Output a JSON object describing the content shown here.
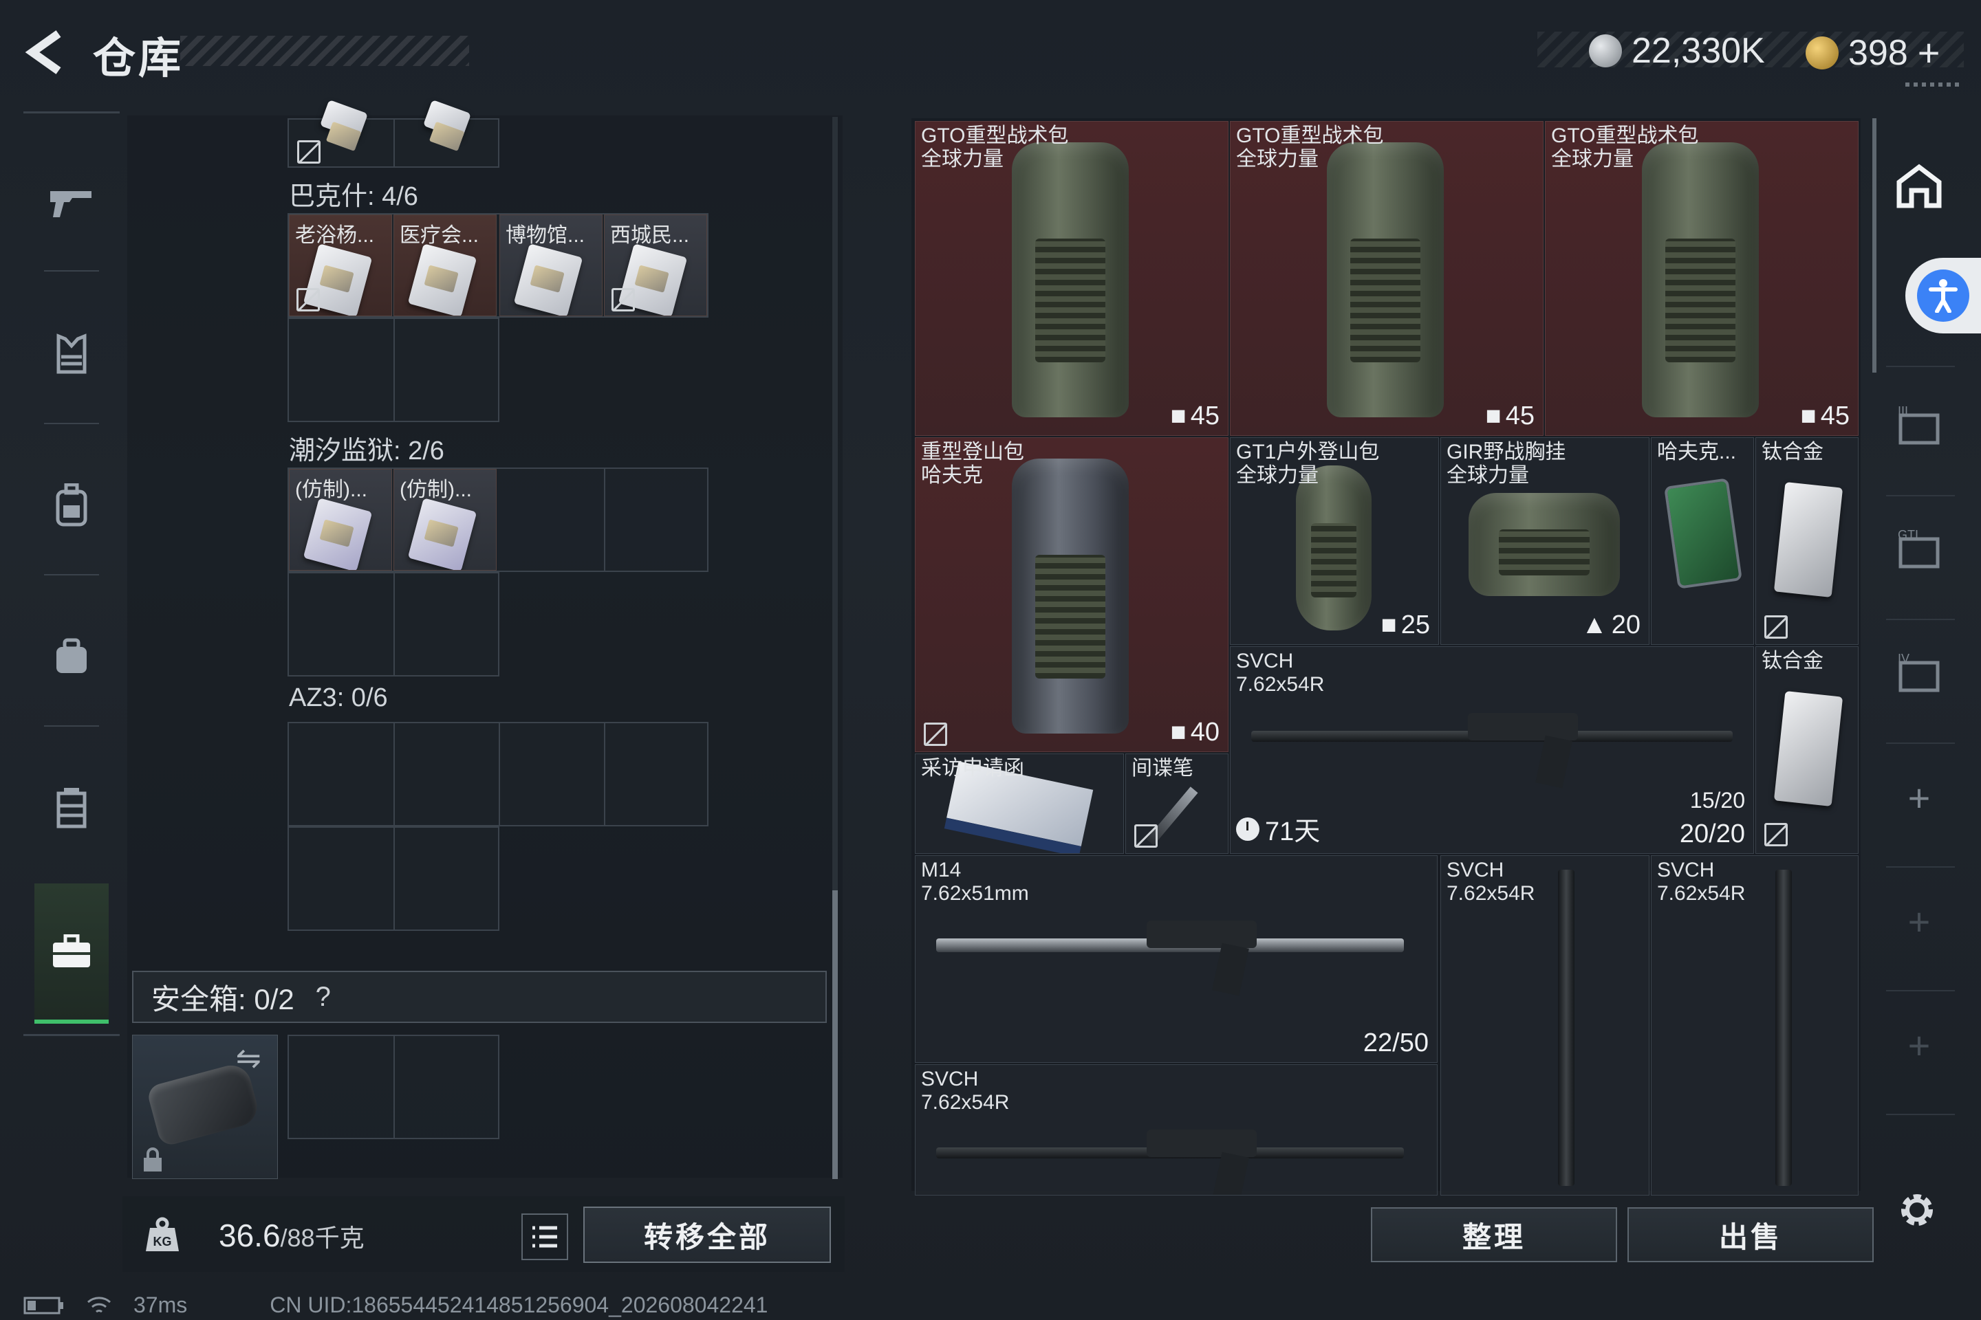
{
  "header": {
    "title": "仓库",
    "currency_1": "22,330K",
    "currency_2": "398",
    "add_label": "+"
  },
  "left_nav": {
    "items": [
      "weapons",
      "armor",
      "backpack",
      "chest-rig",
      "container",
      "toolbox"
    ]
  },
  "storage": {
    "sections": [
      {
        "label": "巴克什: 4/6",
        "cards": [
          "老浴杨...",
          "医疗会...",
          "博物馆...",
          "西城民..."
        ]
      },
      {
        "label": "潮汐监狱: 2/6",
        "cards": [
          "(仿制)...",
          "(仿制)..."
        ]
      },
      {
        "label": "AZ3: 0/6",
        "cards": []
      }
    ],
    "safebox_label": "安全箱: 0/2",
    "safebox_help": "?"
  },
  "bottom_left": {
    "weight_value": "36.6",
    "weight_max": "/88千克",
    "transfer_all": "转移全部"
  },
  "status": {
    "ping": "37ms",
    "uid": "CN UID:18655445241485125​6904_202608042241"
  },
  "stash": {
    "items": [
      {
        "name1": "GTO重型战术包",
        "name2": "全球力量",
        "count": "45"
      },
      {
        "name1": "GTO重型战术包",
        "name2": "全球力量",
        "count": "45"
      },
      {
        "name1": "GTO重型战术包",
        "name2": "全球力量",
        "count": "45"
      },
      {
        "name1": "重型登山包",
        "name2": "哈夫克",
        "count": "40"
      },
      {
        "name1": "GT1户外登山包",
        "name2": "全球力量",
        "count": "25"
      },
      {
        "name1": "GIR野战胸挂",
        "name2": "全球力量",
        "count": "20"
      },
      {
        "name1": "哈夫克...",
        "name2": ""
      },
      {
        "name1": "钛合金",
        "name2": ""
      },
      {
        "name1": "SVCH",
        "name2": "7.62x54R",
        "ammo_top": "15/20",
        "ammo": "20/20",
        "timer": "71天"
      },
      {
        "name1": "钛合金",
        "name2": ""
      },
      {
        "name1": "采访申请函",
        "name2": ""
      },
      {
        "name1": "间谍笔",
        "name2": ""
      },
      {
        "name1": "M14",
        "name2": "7.62x51mm",
        "ammo": "22/50"
      },
      {
        "name1": "SVCH",
        "name2": "7.62x54R"
      },
      {
        "name1": "SVCH",
        "name2": "7.62x54R"
      },
      {
        "name1": "SVCH",
        "name2": "7.62x54R"
      }
    ]
  },
  "actions": {
    "sort": "整理",
    "sell": "出售"
  }
}
